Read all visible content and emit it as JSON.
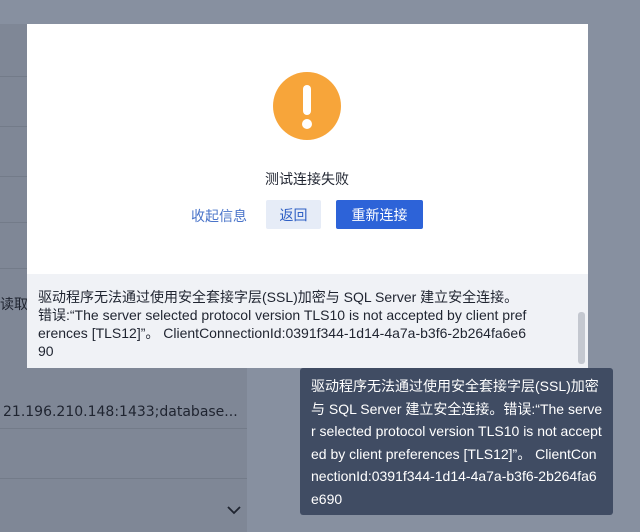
{
  "background": {
    "partial_label": "读取",
    "connection_url": "21.196.210.148:1433;database..."
  },
  "dialog": {
    "title": "测试连接失败",
    "collapse_link": "收起信息",
    "back_button": "返回",
    "reconnect_button": "重新连接",
    "icon": "warning-icon",
    "icon_color": "#f7a53a",
    "error_message": "驱动程序无法通过使用安全套接字层(SSL)加密与 SQL Server 建立安全连接。错误:“The server selected protocol version TLS10 is not accepted by client preferences [TLS12]”。 ClientConnectionId:0391f344-1d14-4a7a-b3f6-2b264fa6e690"
  },
  "tooltip": {
    "text": "驱动程序无法通过使用安全套接字层(SSL)加密与 SQL Server 建立安全连接。错误:“The server selected protocol version TLS10 is not accepted by client preferences [TLS12]”。 ClientConnectionId:0391f344-1d14-4a7a-b3f6-2b264fa6e690"
  },
  "colors": {
    "primary": "#2d63d8",
    "tooltip_bg": "#404c63",
    "overlay": "#8790a0"
  }
}
